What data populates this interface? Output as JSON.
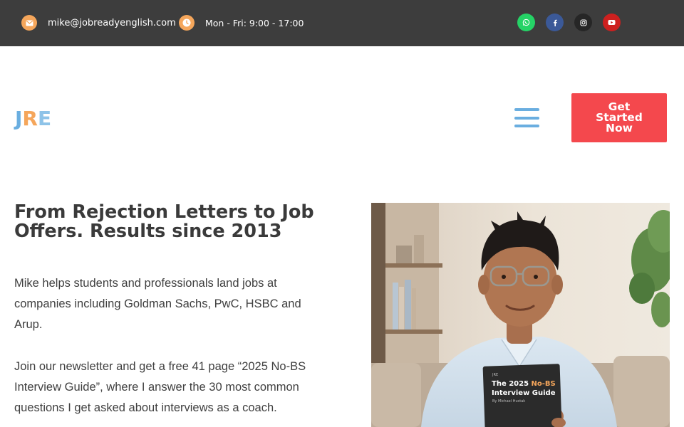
{
  "topbar": {
    "email": "mike@jobreadyenglish.com",
    "email_icon": "envelope-icon",
    "hours": "Mon - Fri: 9:00 - 17:00",
    "hours_icon": "clock-icon",
    "social": [
      {
        "name": "whatsapp-icon",
        "glyph": "✆",
        "color": "#25d366"
      },
      {
        "name": "facebook-icon",
        "glyph": "f",
        "color": "#3b5998"
      },
      {
        "name": "instagram-icon",
        "glyph": "◎",
        "color": "#262626"
      },
      {
        "name": "youtube-icon",
        "glyph": "▶",
        "color": "#cd201f"
      }
    ]
  },
  "header": {
    "logo": {
      "j": "J",
      "r": "R",
      "e": "E"
    },
    "menu_icon": "hamburger-menu-icon",
    "cta_label": "Get Started Now",
    "cta_color": "#f4484d"
  },
  "hero": {
    "title": "From Rejection Letters to Job Offers. Results since 2013",
    "paragraph1": "Mike helps students and professionals land jobs at companies including Goldman Sachs, PwC, HSBC and Arup.",
    "paragraph2": "Join our newsletter and get a free 41 page “2025 No-BS Interview Guide”, where I answer the 30 most common questions I get asked about interviews as a coach.",
    "book": {
      "small": "JRE",
      "line1_a": "The 2025 ",
      "line1_b": "No-BS",
      "line2": "Interview Guide",
      "author": "By Michael Hustak"
    }
  },
  "colors": {
    "topbar_bg": "#3d3d3d",
    "icon_orange": "#f5a65b",
    "logo_blue": "#6aaee0",
    "accent_red": "#f4484d"
  }
}
